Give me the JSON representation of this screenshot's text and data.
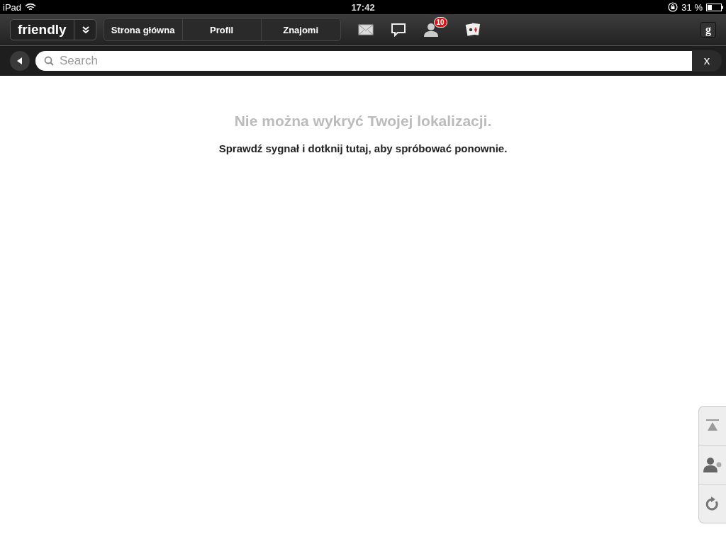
{
  "status_bar": {
    "device": "iPad",
    "time": "17:42",
    "battery": "31 %"
  },
  "nav": {
    "logo": "friendly",
    "tabs": [
      {
        "label": "Strona główna"
      },
      {
        "label": "Profil"
      },
      {
        "label": "Znajomi"
      }
    ],
    "friend_badge": "10",
    "account_letter": "g"
  },
  "search": {
    "placeholder": "Search",
    "clear": "x"
  },
  "message": {
    "title": "Nie można wykryć Twojej lokalizacji.",
    "hint": "Sprawdź sygnał i dotknij tutaj, aby spróbować ponownie."
  }
}
